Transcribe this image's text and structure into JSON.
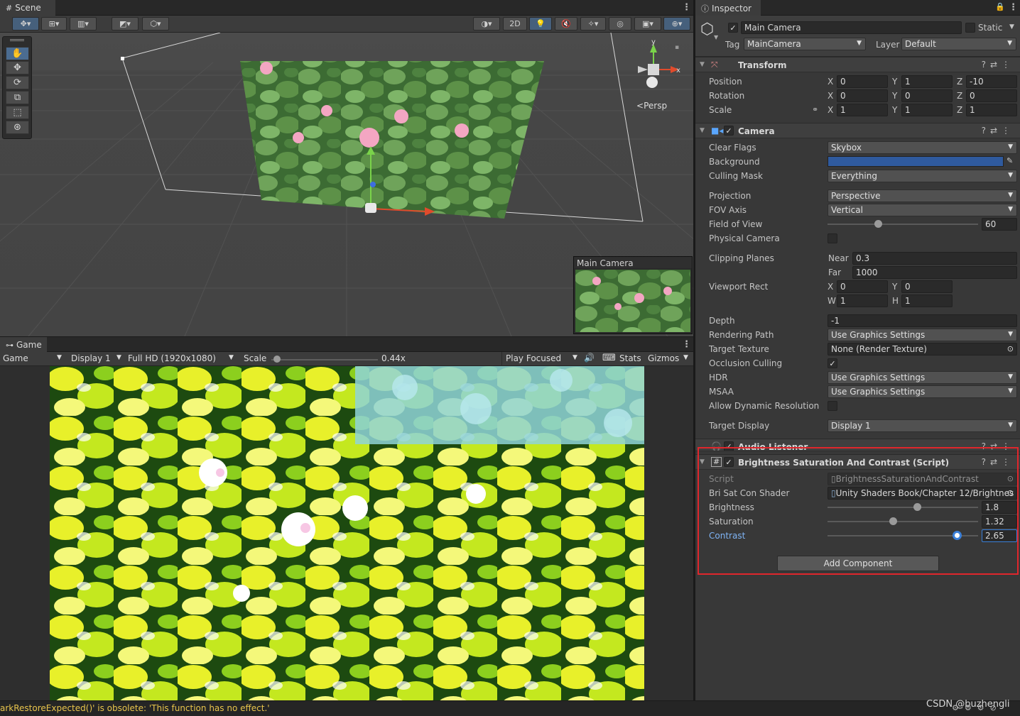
{
  "scene": {
    "tab_label": "Scene",
    "persp_label": "Persp",
    "toolbar_2d": "2D",
    "gizmo_y": "y",
    "gizmo_x": "x",
    "camera_preview_title": "Main Camera"
  },
  "game": {
    "tab_label": "Game",
    "view_mode": "Game",
    "display": "Display 1",
    "resolution": "Full HD (1920x1080)",
    "scale_label": "Scale",
    "scale_value": "0.44x",
    "scale_fraction": 0.02,
    "play_mode": "Play Focused",
    "stats": "Stats",
    "gizmos": "Gizmos"
  },
  "inspector": {
    "tab_label": "Inspector",
    "object_name": "Main Camera",
    "static_label": "Static",
    "tag_label": "Tag",
    "tag_value": "MainCamera",
    "layer_label": "Layer",
    "layer_value": "Default",
    "transform": {
      "title": "Transform",
      "position_label": "Position",
      "rotation_label": "Rotation",
      "scale_label": "Scale",
      "position": {
        "x": "0",
        "y": "1",
        "z": "-10"
      },
      "rotation": {
        "x": "0",
        "y": "0",
        "z": "0"
      },
      "scale": {
        "x": "1",
        "y": "1",
        "z": "1"
      }
    },
    "camera": {
      "title": "Camera",
      "clear_flags_label": "Clear Flags",
      "clear_flags": "Skybox",
      "background_label": "Background",
      "background_color": "#2f5a9e",
      "culling_mask_label": "Culling Mask",
      "culling_mask": "Everything",
      "projection_label": "Projection",
      "projection": "Perspective",
      "fov_axis_label": "FOV Axis",
      "fov_axis": "Vertical",
      "fov_label": "Field of View",
      "fov": "60",
      "fov_fraction": 0.34,
      "physical_camera_label": "Physical Camera",
      "clipping_planes_label": "Clipping Planes",
      "near_label": "Near",
      "near": "0.3",
      "far_label": "Far",
      "far": "1000",
      "viewport_rect_label": "Viewport Rect",
      "vp_x": "0",
      "vp_y": "0",
      "vp_w": "1",
      "vp_h": "1",
      "depth_label": "Depth",
      "depth": "-1",
      "rendering_path_label": "Rendering Path",
      "rendering_path": "Use Graphics Settings",
      "target_texture_label": "Target Texture",
      "target_texture": "None (Render Texture)",
      "occlusion_culling_label": "Occlusion Culling",
      "hdr_label": "HDR",
      "hdr": "Use Graphics Settings",
      "msaa_label": "MSAA",
      "msaa": "Use Graphics Settings",
      "allow_dynamic_label": "Allow Dynamic Resolution",
      "target_display_label": "Target Display",
      "target_display": "Display 1"
    },
    "audio_listener": {
      "title": "Audio Listener"
    },
    "bsc": {
      "title": "Brightness Saturation And Contrast (Script)",
      "script_label": "Script",
      "script_value": "BrightnessSaturationAndContrast",
      "shader_label": "Bri Sat Con Shader",
      "shader_value": "Unity Shaders Book/Chapter 12/Brightnes",
      "brightness_label": "Brightness",
      "brightness": "1.8",
      "brightness_fraction": 0.6,
      "saturation_label": "Saturation",
      "saturation": "1.32",
      "saturation_fraction": 0.44,
      "contrast_label": "Contrast",
      "contrast": "2.65",
      "contrast_fraction": 0.86
    },
    "add_component": "Add Component"
  },
  "status": {
    "message": "arkRestoreExpected()' is obsolete: 'This function has no effect.'",
    "watermark": "CSDN @buzhengli"
  }
}
